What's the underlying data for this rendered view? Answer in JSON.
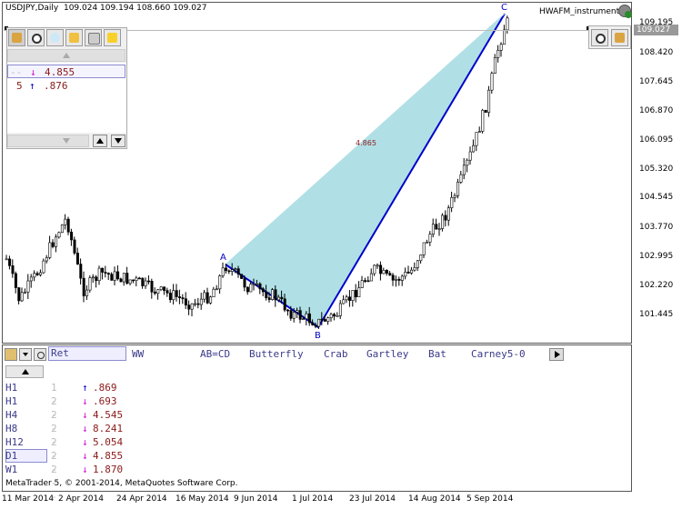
{
  "window": {
    "symbol_title": "USDJPY,Daily  109.024 109.194 108.660 109.027",
    "instrument_name": "HWAFM_instrument",
    "current_price": "109.027"
  },
  "price_axis": {
    "ticks": [
      "109.195",
      "108.420",
      "107.645",
      "106.870",
      "106.095",
      "105.320",
      "104.545",
      "103.770",
      "102.995",
      "102.220",
      "101.445"
    ]
  },
  "time_axis": {
    "ticks": [
      "11 Mar 2014",
      "2 Apr 2014",
      "24 Apr 2014",
      "16 May 2014",
      "9 Jun 2014",
      "1 Jul 2014",
      "23 Jul 2014",
      "14 Aug 2014",
      "5 Sep 2014"
    ]
  },
  "pattern": {
    "labels": {
      "a": "A",
      "b": "B",
      "c": "C"
    },
    "ratio_label": "4.865",
    "fill_color": "#b0e0e6",
    "line_color": "#0000cc"
  },
  "tool_panel": {
    "buttons": [
      "folder-icon",
      "eye-icon",
      "bulb-icon",
      "search-settings-icon",
      "lock-icon",
      "star-settings-icon"
    ],
    "ratios": [
      {
        "prefix": "--",
        "arrow": "↓",
        "value": "4.855"
      },
      {
        "prefix": "5",
        "arrow": "↑",
        "value": ".876"
      }
    ]
  },
  "bottom_panel": {
    "tabs": [
      "Ret",
      "WW",
      "AB=CD",
      "Butterfly",
      "Crab",
      "Gartley",
      "Bat",
      "Carney5-0"
    ],
    "timeframes": [
      {
        "name": "H1",
        "mid": "1 --",
        "arrow": "↑",
        "value": ".869"
      },
      {
        "name": "H1",
        "mid": "2 --",
        "arrow": "↓",
        "value": ".693"
      },
      {
        "name": "H4",
        "mid": "2 --",
        "arrow": "↓",
        "value": "4.545"
      },
      {
        "name": "H8",
        "mid": "2 --",
        "arrow": "↓",
        "value": "8.241"
      },
      {
        "name": "H12",
        "mid": "2 --",
        "arrow": "↓",
        "value": "5.054"
      },
      {
        "name": "D1",
        "mid": "2 --",
        "arrow": "↓",
        "value": "4.855"
      },
      {
        "name": "W1",
        "mid": "2 --",
        "arrow": "↓",
        "value": "1.870"
      }
    ],
    "selected_timeframe": "D1",
    "copyright": "MetaTrader 5, © 2001-2014, MetaQuotes Software Corp."
  },
  "colors": {
    "arrow_up": "#0000cc",
    "arrow_down": "#d010d0",
    "value": "#8b1a1a"
  }
}
